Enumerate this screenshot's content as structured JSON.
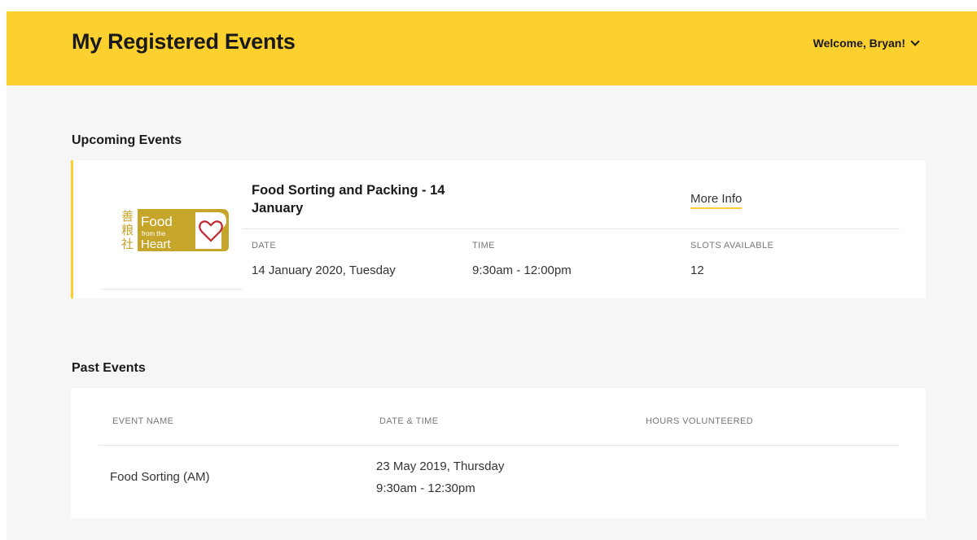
{
  "header": {
    "title": "My Registered Events",
    "welcome": "Welcome, Bryan!",
    "color": "#fcd02e"
  },
  "upcoming": {
    "section_title": "Upcoming Events",
    "events": [
      {
        "logo": {
          "chinese": [
            "善",
            "粮",
            "社"
          ],
          "line1": "Food",
          "line2": "from the",
          "line3": "Heart"
        },
        "title": "Food Sorting and Packing - 14 January",
        "more_info": "More Info",
        "date_label": "DATE",
        "date_value": "14 January 2020, Tuesday",
        "time_label": "TIME",
        "time_value": "9:30am - 12:00pm",
        "slots_label": "SLOTS AVAILABLE",
        "slots_value": "12"
      }
    ]
  },
  "past": {
    "section_title": "Past Events",
    "columns": [
      "EVENT NAME",
      "DATE & TIME",
      "HOURS VOLUNTEERED"
    ],
    "rows": [
      {
        "event_name": "Food Sorting (AM)",
        "date": "23 May 2019, Thursday",
        "time": "9:30am - 12:30pm",
        "hours": ""
      }
    ]
  }
}
